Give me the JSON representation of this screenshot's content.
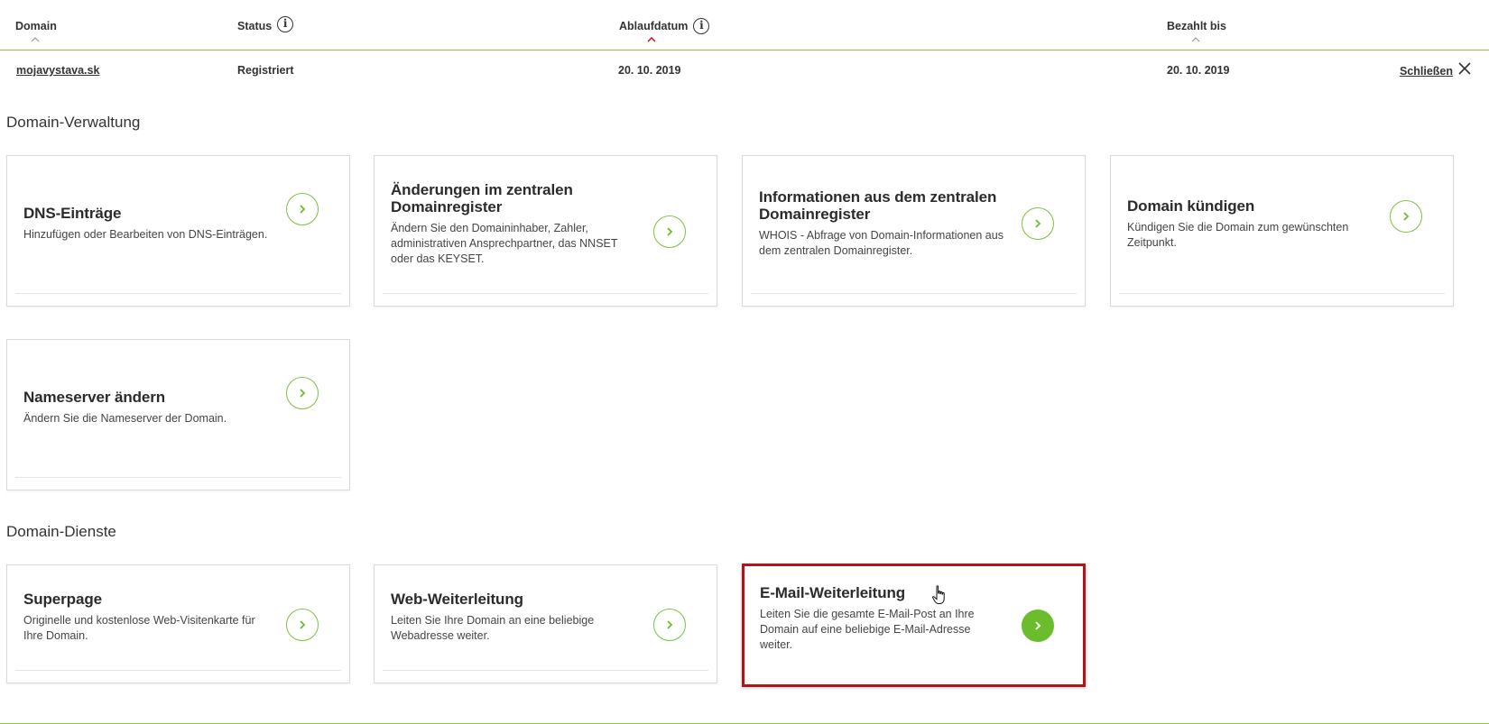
{
  "table": {
    "columns": {
      "domain": "Domain",
      "status": "Status",
      "expiry": "Ablaufdatum",
      "paid_until": "Bezahlt bis"
    },
    "row": {
      "domain": "mojavystava.sk",
      "status": "Registriert",
      "expiry": "20. 10. 2019",
      "paid_until": "20. 10. 2019",
      "close_label": "Schließen"
    }
  },
  "sections": {
    "management_title": "Domain-Verwaltung",
    "services_title": "Domain-Dienste"
  },
  "cards": {
    "dns": {
      "title": "DNS-Einträge",
      "desc": "Hinzufügen oder Bearbeiten von DNS-Einträgen."
    },
    "registry_changes": {
      "title": "Änderungen im zentralen Domainregister",
      "desc": "Ändern Sie den Domaininhaber, Zahler, administrativen Ansprechpartner, das NNSET oder das KEYSET."
    },
    "registry_info": {
      "title": "Informationen aus dem zentralen Domainregister",
      "desc": "WHOIS - Abfrage von Domain-Informationen aus dem zentralen Domainregister."
    },
    "cancel": {
      "title": "Domain kündigen",
      "desc": "Kündigen Sie die Domain zum gewünschten Zeitpunkt."
    },
    "nameserver": {
      "title": "Nameserver ändern",
      "desc": "Ändern Sie die Nameserver der Domain."
    },
    "superpage": {
      "title": "Superpage",
      "desc": "Originelle und kostenlose Web-Visitenkarte für Ihre Domain."
    },
    "web_redirect": {
      "title": "Web-Weiterleitung",
      "desc": "Leiten Sie Ihre Domain an eine beliebige Webadresse weiter."
    },
    "email_redirect": {
      "title": "E-Mail-Weiterleitung",
      "desc": "Leiten Sie die gesamte E-Mail-Post an Ihre Domain auf eine beliebige E-Mail-Adresse weiter."
    }
  },
  "icons": {
    "info": "info-icon",
    "sort": "chevron-up-icon",
    "close": "close-icon",
    "arrow": "chevron-right-icon",
    "cursor": "hand-pointer-cursor"
  },
  "colors": {
    "accent_green": "#6cbd2e",
    "active_sort_red": "#d0021b",
    "highlight_red": "#b3141a"
  }
}
